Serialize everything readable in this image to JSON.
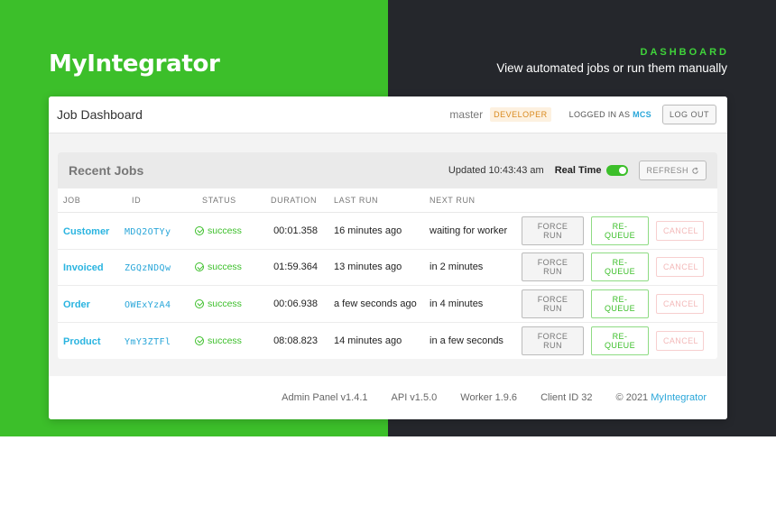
{
  "hero": {
    "brand": "MyIntegrator",
    "eyebrow": "DASHBOARD",
    "subtitle": "View automated jobs or run them manually"
  },
  "header": {
    "title": "Job Dashboard",
    "branch": "master",
    "role": "DEVELOPER",
    "logged_in_prefix": "LOGGED IN AS",
    "user": "MCS",
    "logout_label": "LOG OUT"
  },
  "jobs_panel": {
    "title": "Recent Jobs",
    "updated": "Updated 10:43:43 am",
    "realtime_label": "Real Time",
    "realtime_on": true,
    "refresh_label": "REFRESH",
    "columns": [
      "JOB",
      "ID",
      "STATUS",
      "DURATION",
      "LAST RUN",
      "NEXT RUN"
    ],
    "rows": [
      {
        "job": "Customer",
        "id": "MDQ2OTYy",
        "status": "success",
        "duration": "00:01.358",
        "last_run": "16 minutes ago",
        "next_run": "waiting for worker"
      },
      {
        "job": "Invoiced",
        "id": "ZGQzNDQw",
        "status": "success",
        "duration": "01:59.364",
        "last_run": "13 minutes ago",
        "next_run": "in 2 minutes"
      },
      {
        "job": "Order",
        "id": "OWExYzA4",
        "status": "success",
        "duration": "00:06.938",
        "last_run": "a few seconds ago",
        "next_run": "in 4 minutes"
      },
      {
        "job": "Product",
        "id": "YmY3ZTFl",
        "status": "success",
        "duration": "08:08.823",
        "last_run": "14 minutes ago",
        "next_run": "in a few seconds"
      }
    ],
    "actions": {
      "force_run": "FORCE RUN",
      "requeue": "RE-QUEUE",
      "cancel": "CANCEL"
    }
  },
  "footer": {
    "admin_panel": "Admin Panel v1.4.1",
    "api": "API v1.5.0",
    "worker": "Worker 1.9.6",
    "client_id": "Client ID 32",
    "copyright_prefix": "© 2021",
    "copyright_brand": "MyIntegrator"
  },
  "colors": {
    "brand_green": "#3cbf2a",
    "dark_bg": "#25272c",
    "link_blue": "#29a6d9",
    "role_orange": "#d98a1e"
  }
}
